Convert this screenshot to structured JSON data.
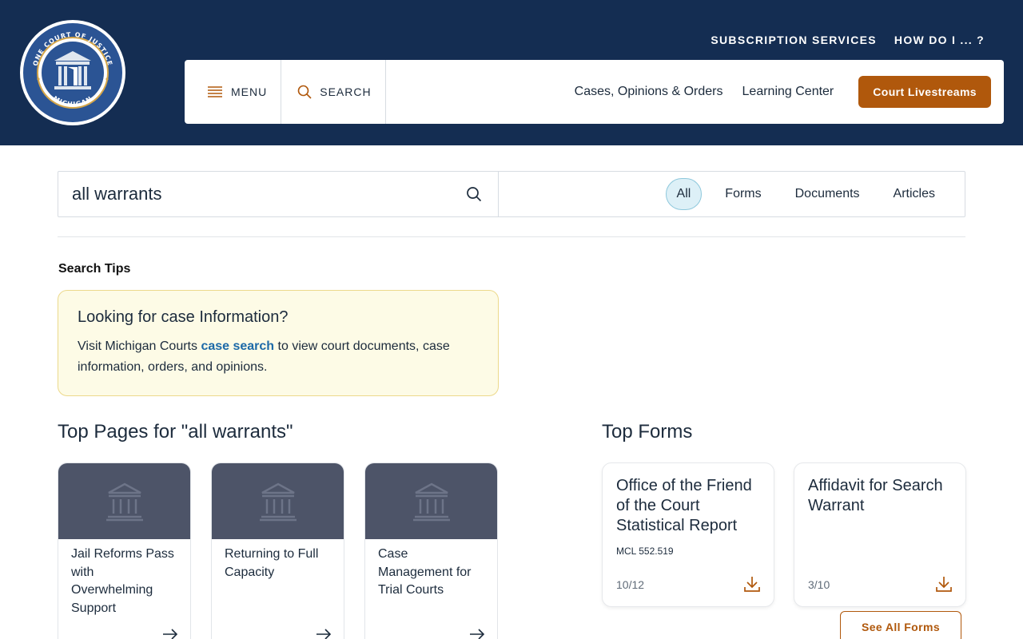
{
  "header": {
    "seal": {
      "top_text": "ONE COURT OF JUSTICE",
      "bottom_text": "MICHIGAN"
    },
    "utility_links": [
      "SUBSCRIPTION SERVICES",
      "HOW DO I ... ?"
    ],
    "menu_label": "MENU",
    "search_label": "SEARCH",
    "nav_links": [
      "Cases, Opinions & Orders",
      "Learning Center"
    ],
    "livestream_label": "Court Livestreams"
  },
  "search": {
    "query": "all warrants",
    "filters": [
      "All",
      "Forms",
      "Documents",
      "Articles"
    ],
    "active_filter": "All"
  },
  "tips": {
    "heading": "Search Tips",
    "card_title": "Looking for case Information?",
    "text_before": "Visit Michigan Courts ",
    "link_text": "case search",
    "text_after": " to view court documents, case information, orders, and opinions."
  },
  "top_pages": {
    "heading": "Top Pages for \"all warrants\"",
    "items": [
      {
        "title": "Jail Reforms Pass with Overwhelming Support"
      },
      {
        "title": "Returning to Full Capacity"
      },
      {
        "title": "Case Management for Trial Courts"
      }
    ]
  },
  "top_forms": {
    "heading": "Top Forms",
    "items": [
      {
        "title": "Office of the Friend of the Court Statistical Report",
        "code": "MCL 552.519",
        "date": "10/12"
      },
      {
        "title": "Affidavit for Search Warrant",
        "code": "",
        "date": "3/10"
      }
    ],
    "see_all_label": "See All Forms"
  },
  "colors": {
    "header_bg": "#142d52",
    "accent": "#b0580c",
    "link": "#1d6aa8",
    "tip_bg": "#fdfbe6",
    "card_thumb": "#4d5468"
  }
}
